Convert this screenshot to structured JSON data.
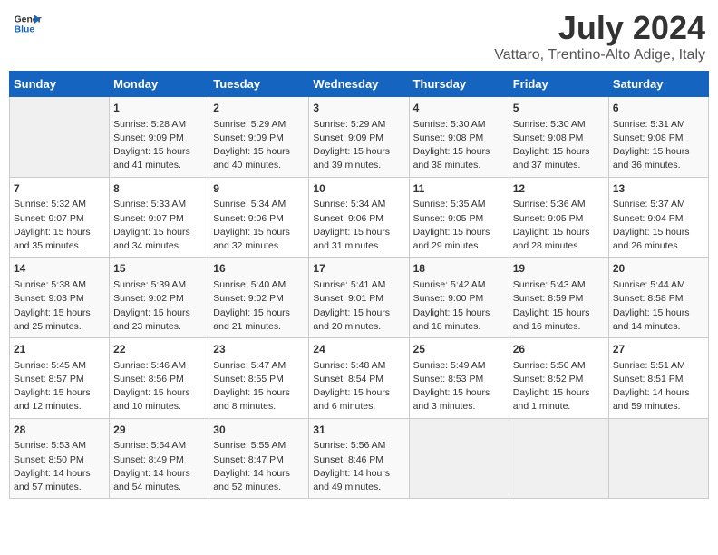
{
  "header": {
    "logo_line1": "General",
    "logo_line2": "Blue",
    "main_title": "July 2024",
    "subtitle": "Vattaro, Trentino-Alto Adige, Italy"
  },
  "days_of_week": [
    "Sunday",
    "Monday",
    "Tuesday",
    "Wednesday",
    "Thursday",
    "Friday",
    "Saturday"
  ],
  "weeks": [
    [
      {
        "day": "",
        "info": ""
      },
      {
        "day": "1",
        "info": "Sunrise: 5:28 AM\nSunset: 9:09 PM\nDaylight: 15 hours\nand 41 minutes."
      },
      {
        "day": "2",
        "info": "Sunrise: 5:29 AM\nSunset: 9:09 PM\nDaylight: 15 hours\nand 40 minutes."
      },
      {
        "day": "3",
        "info": "Sunrise: 5:29 AM\nSunset: 9:09 PM\nDaylight: 15 hours\nand 39 minutes."
      },
      {
        "day": "4",
        "info": "Sunrise: 5:30 AM\nSunset: 9:08 PM\nDaylight: 15 hours\nand 38 minutes."
      },
      {
        "day": "5",
        "info": "Sunrise: 5:30 AM\nSunset: 9:08 PM\nDaylight: 15 hours\nand 37 minutes."
      },
      {
        "day": "6",
        "info": "Sunrise: 5:31 AM\nSunset: 9:08 PM\nDaylight: 15 hours\nand 36 minutes."
      }
    ],
    [
      {
        "day": "7",
        "info": "Sunrise: 5:32 AM\nSunset: 9:07 PM\nDaylight: 15 hours\nand 35 minutes."
      },
      {
        "day": "8",
        "info": "Sunrise: 5:33 AM\nSunset: 9:07 PM\nDaylight: 15 hours\nand 34 minutes."
      },
      {
        "day": "9",
        "info": "Sunrise: 5:34 AM\nSunset: 9:06 PM\nDaylight: 15 hours\nand 32 minutes."
      },
      {
        "day": "10",
        "info": "Sunrise: 5:34 AM\nSunset: 9:06 PM\nDaylight: 15 hours\nand 31 minutes."
      },
      {
        "day": "11",
        "info": "Sunrise: 5:35 AM\nSunset: 9:05 PM\nDaylight: 15 hours\nand 29 minutes."
      },
      {
        "day": "12",
        "info": "Sunrise: 5:36 AM\nSunset: 9:05 PM\nDaylight: 15 hours\nand 28 minutes."
      },
      {
        "day": "13",
        "info": "Sunrise: 5:37 AM\nSunset: 9:04 PM\nDaylight: 15 hours\nand 26 minutes."
      }
    ],
    [
      {
        "day": "14",
        "info": "Sunrise: 5:38 AM\nSunset: 9:03 PM\nDaylight: 15 hours\nand 25 minutes."
      },
      {
        "day": "15",
        "info": "Sunrise: 5:39 AM\nSunset: 9:02 PM\nDaylight: 15 hours\nand 23 minutes."
      },
      {
        "day": "16",
        "info": "Sunrise: 5:40 AM\nSunset: 9:02 PM\nDaylight: 15 hours\nand 21 minutes."
      },
      {
        "day": "17",
        "info": "Sunrise: 5:41 AM\nSunset: 9:01 PM\nDaylight: 15 hours\nand 20 minutes."
      },
      {
        "day": "18",
        "info": "Sunrise: 5:42 AM\nSunset: 9:00 PM\nDaylight: 15 hours\nand 18 minutes."
      },
      {
        "day": "19",
        "info": "Sunrise: 5:43 AM\nSunset: 8:59 PM\nDaylight: 15 hours\nand 16 minutes."
      },
      {
        "day": "20",
        "info": "Sunrise: 5:44 AM\nSunset: 8:58 PM\nDaylight: 15 hours\nand 14 minutes."
      }
    ],
    [
      {
        "day": "21",
        "info": "Sunrise: 5:45 AM\nSunset: 8:57 PM\nDaylight: 15 hours\nand 12 minutes."
      },
      {
        "day": "22",
        "info": "Sunrise: 5:46 AM\nSunset: 8:56 PM\nDaylight: 15 hours\nand 10 minutes."
      },
      {
        "day": "23",
        "info": "Sunrise: 5:47 AM\nSunset: 8:55 PM\nDaylight: 15 hours\nand 8 minutes."
      },
      {
        "day": "24",
        "info": "Sunrise: 5:48 AM\nSunset: 8:54 PM\nDaylight: 15 hours\nand 6 minutes."
      },
      {
        "day": "25",
        "info": "Sunrise: 5:49 AM\nSunset: 8:53 PM\nDaylight: 15 hours\nand 3 minutes."
      },
      {
        "day": "26",
        "info": "Sunrise: 5:50 AM\nSunset: 8:52 PM\nDaylight: 15 hours\nand 1 minute."
      },
      {
        "day": "27",
        "info": "Sunrise: 5:51 AM\nSunset: 8:51 PM\nDaylight: 14 hours\nand 59 minutes."
      }
    ],
    [
      {
        "day": "28",
        "info": "Sunrise: 5:53 AM\nSunset: 8:50 PM\nDaylight: 14 hours\nand 57 minutes."
      },
      {
        "day": "29",
        "info": "Sunrise: 5:54 AM\nSunset: 8:49 PM\nDaylight: 14 hours\nand 54 minutes."
      },
      {
        "day": "30",
        "info": "Sunrise: 5:55 AM\nSunset: 8:47 PM\nDaylight: 14 hours\nand 52 minutes."
      },
      {
        "day": "31",
        "info": "Sunrise: 5:56 AM\nSunset: 8:46 PM\nDaylight: 14 hours\nand 49 minutes."
      },
      {
        "day": "",
        "info": ""
      },
      {
        "day": "",
        "info": ""
      },
      {
        "day": "",
        "info": ""
      }
    ]
  ]
}
